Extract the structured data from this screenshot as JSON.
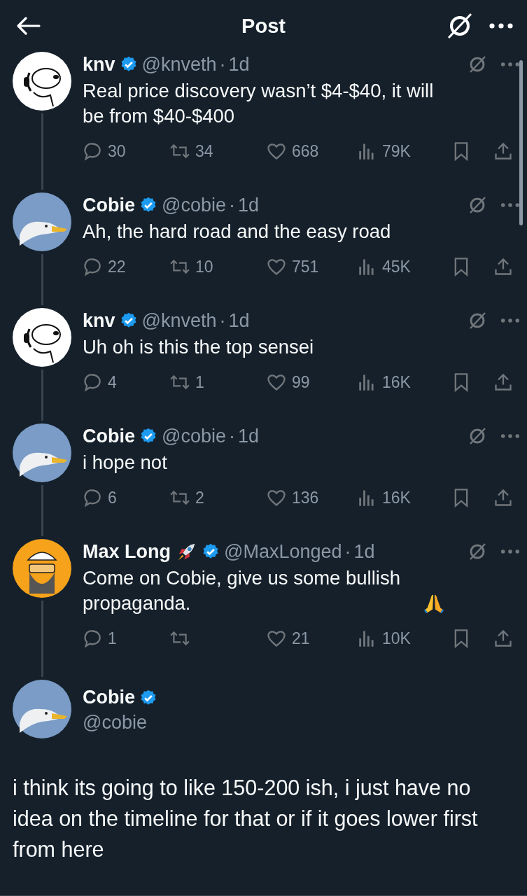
{
  "header": {
    "title": "Post"
  },
  "replies": [
    {
      "name": "knv",
      "verified": true,
      "handle": "@knveth",
      "separator": "·",
      "time": "1d",
      "avatar": {
        "kind": "dog"
      },
      "body": "Real price discovery wasn’t $4-$40, it will be from $40-$400",
      "stats": {
        "replies": "30",
        "reposts": "34",
        "likes": "668",
        "views": "79K"
      }
    },
    {
      "name": "Cobie",
      "verified": true,
      "handle": "@cobie",
      "separator": "·",
      "time": "1d",
      "avatar": {
        "kind": "gull"
      },
      "body": "Ah, the hard road and the easy road",
      "stats": {
        "replies": "22",
        "reposts": "10",
        "likes": "751",
        "views": "45K"
      }
    },
    {
      "name": "knv",
      "verified": true,
      "handle": "@knveth",
      "separator": "·",
      "time": "1d",
      "avatar": {
        "kind": "dog"
      },
      "body": "Uh oh is this the top sensei",
      "stats": {
        "replies": "4",
        "reposts": "1",
        "likes": "99",
        "views": "16K"
      }
    },
    {
      "name": "Cobie",
      "verified": true,
      "handle": "@cobie",
      "separator": "·",
      "time": "1d",
      "avatar": {
        "kind": "gull"
      },
      "body": "i hope not",
      "stats": {
        "replies": "6",
        "reposts": "2",
        "likes": "136",
        "views": "16K"
      }
    },
    {
      "name": "Max Long",
      "name_emoji": {
        "kind": "rocket"
      },
      "verified": true,
      "handle": "@MaxLonged",
      "separator": "·",
      "time": "1d",
      "avatar": {
        "kind": "cartoon"
      },
      "body": "Come on Cobie, give us some bullish propaganda.",
      "body_emoji": {
        "kind": "praying-hands"
      },
      "stats": {
        "replies": "1",
        "likes": "21",
        "views": "10K"
      }
    }
  ],
  "main_post": {
    "name": "Cobie",
    "verified": true,
    "handle": "@cobie",
    "avatar": {
      "kind": "gull"
    },
    "body": "i think its going to like 150-200 ish, i just have no idea on the timeline for that or if it goes lower first from here"
  }
}
